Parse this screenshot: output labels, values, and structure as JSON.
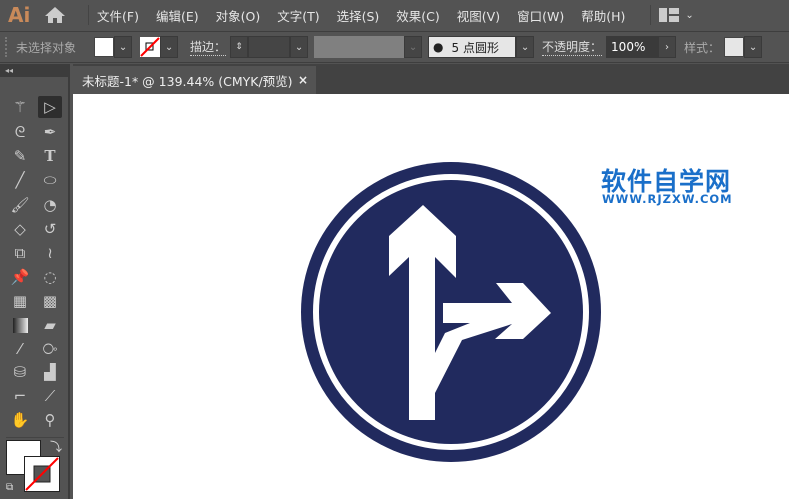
{
  "app": {
    "logo": "Ai"
  },
  "menu": [
    "文件(F)",
    "编辑(E)",
    "对象(O)",
    "文字(T)",
    "选择(S)",
    "效果(C)",
    "视图(V)",
    "窗口(W)",
    "帮助(H)"
  ],
  "control": {
    "selection": "未选择对象",
    "stroke_label": "描边：",
    "brush": "5 点圆形",
    "opacity_label": "不透明度：",
    "opacity": "100%",
    "style_label": "样式："
  },
  "tab": {
    "title": "未标题-1* @ 139.44% (CMYK/预览)",
    "close": "×"
  },
  "watermark": {
    "cn": "软件自学网",
    "url": "WWW.RJZXW.COM"
  },
  "colors": {
    "sign": "#212a5e",
    "watermark": "#1a6fc9",
    "accent": "#c98a5a"
  }
}
